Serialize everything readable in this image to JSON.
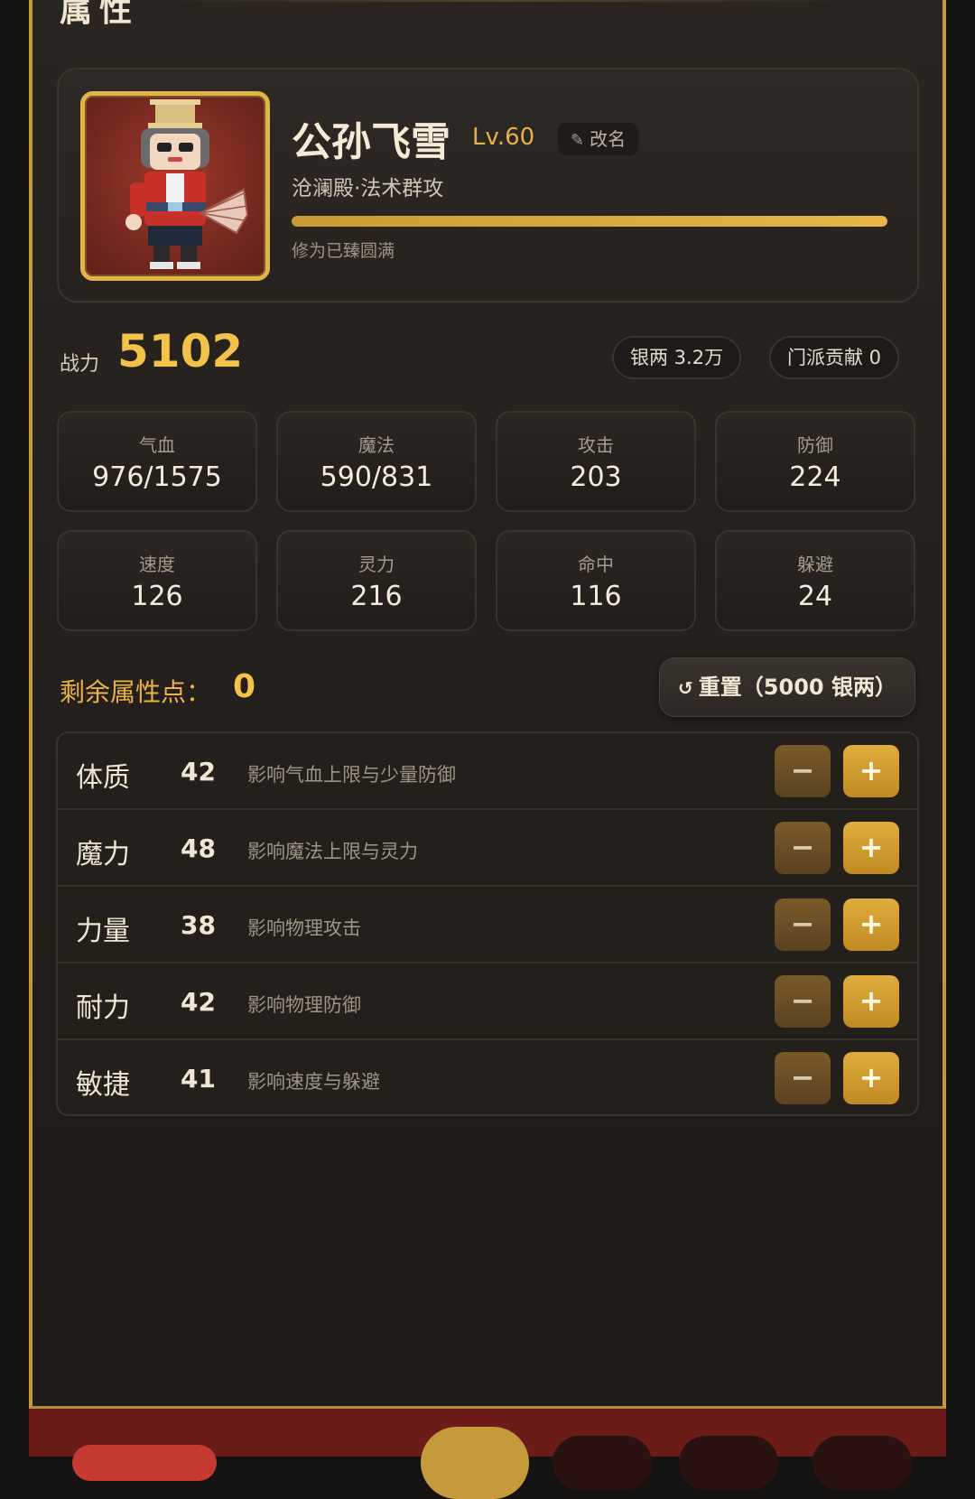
{
  "panel": {
    "title": "属性"
  },
  "profile": {
    "name": "公孙飞雪",
    "level": "Lv.60",
    "rename_label": "改名",
    "school": "沧澜殿·法术群攻",
    "exp_progress": 1.0,
    "exp_text": "修为已臻圆满"
  },
  "combat": {
    "label": "战力",
    "value": "5102",
    "silver": "银两 3.2万",
    "contribution": "门派贡献 0"
  },
  "stats": [
    {
      "label": "气血",
      "value": "976/1575"
    },
    {
      "label": "魔法",
      "value": "590/831"
    },
    {
      "label": "攻击",
      "value": "203"
    },
    {
      "label": "防御",
      "value": "224"
    },
    {
      "label": "速度",
      "value": "126"
    },
    {
      "label": "灵力",
      "value": "216"
    },
    {
      "label": "命中",
      "value": "116"
    },
    {
      "label": "躲避",
      "value": "24"
    }
  ],
  "points": {
    "label": "剩余属性点：",
    "value": "0",
    "reset_label": "重置（5000 银两）"
  },
  "attributes": [
    {
      "name": "体质",
      "value": "42",
      "desc": "影响气血上限与少量防御",
      "minus": "−",
      "plus": "+"
    },
    {
      "name": "魔力",
      "value": "48",
      "desc": "影响魔法上限与灵力",
      "minus": "−",
      "plus": "+"
    },
    {
      "name": "力量",
      "value": "38",
      "desc": "影响物理攻击",
      "minus": "−",
      "plus": "+"
    },
    {
      "name": "耐力",
      "value": "42",
      "desc": "影响物理防御",
      "minus": "−",
      "plus": "+"
    },
    {
      "name": "敏捷",
      "value": "41",
      "desc": "影响速度与躲避",
      "minus": "−",
      "plus": "+"
    }
  ],
  "icons": {
    "rename": "pencil-icon",
    "reset": "refresh-icon"
  },
  "colors": {
    "accent": "#e3b24a",
    "plus_button": "#d9a23a",
    "frame": "#c49a3a"
  }
}
